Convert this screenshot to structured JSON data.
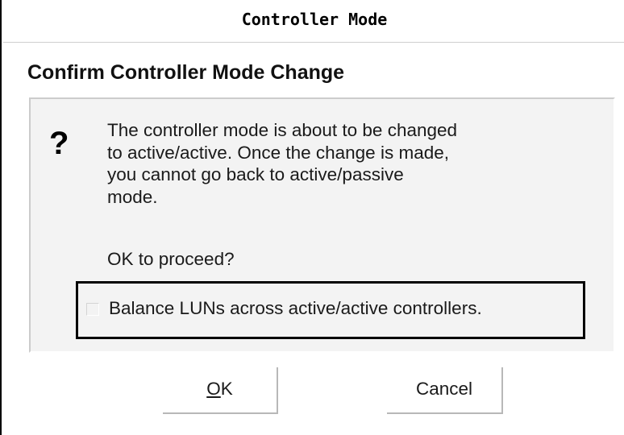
{
  "window": {
    "title": "Controller Mode"
  },
  "dialog": {
    "heading": "Confirm Controller Mode Change",
    "icon": "question-mark-icon",
    "message_lines": [
      "The controller mode is about to be changed",
      "to active/active. Once the change is made,",
      "you cannot go back to active/passive",
      "mode."
    ],
    "prompt": "OK to proceed?",
    "balance_checkbox": {
      "label": "Balance LUNs across active/active controllers.",
      "checked": false
    }
  },
  "buttons": {
    "ok_mnemonic": "O",
    "ok_rest": "K",
    "cancel_label": "Cancel"
  }
}
